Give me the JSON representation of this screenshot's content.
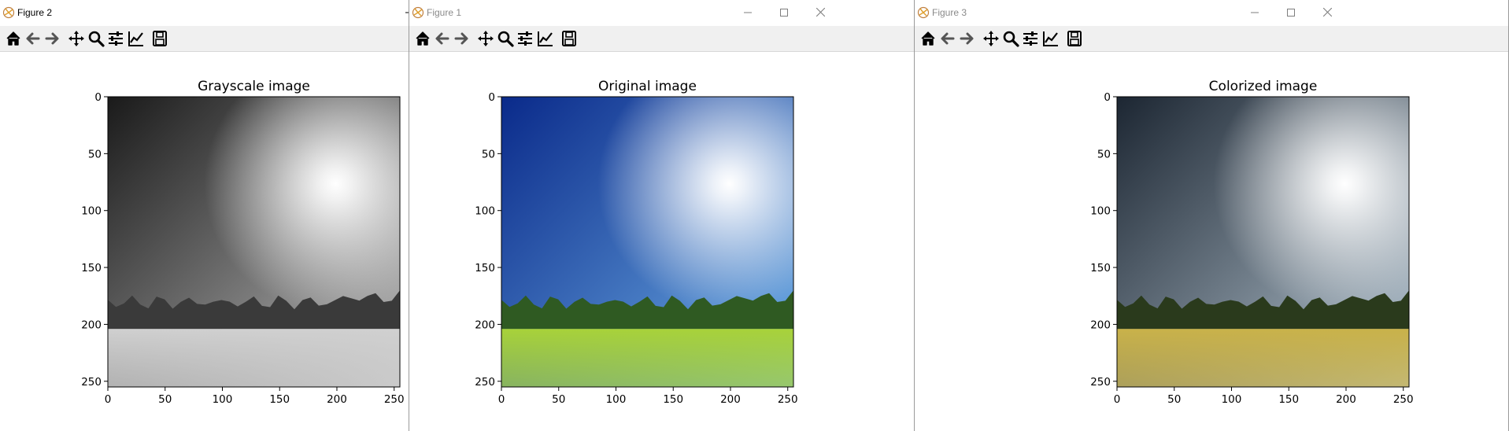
{
  "windows": [
    {
      "key": "w2",
      "title": "Figure 2",
      "active": true,
      "plot_title": "Grayscale image",
      "image": "grayscale"
    },
    {
      "key": "w1",
      "title": "Figure 1",
      "active": false,
      "plot_title": "Original image",
      "image": "original"
    },
    {
      "key": "w3",
      "title": "Figure 3",
      "active": false,
      "plot_title": "Colorized image",
      "image": "colorized"
    }
  ],
  "toolbar_icons": [
    "home-icon",
    "back-arrow-icon",
    "forward-arrow-icon",
    "pan-icon",
    "zoom-icon",
    "configure-subplots-icon",
    "edit-axis-icon",
    "save-icon"
  ],
  "axes": {
    "x_ticks": [
      "0",
      "50",
      "100",
      "150",
      "200",
      "250"
    ],
    "y_ticks": [
      "0",
      "50",
      "100",
      "150",
      "200",
      "250"
    ],
    "xlim": [
      0,
      255
    ],
    "ylim": [
      255,
      0
    ]
  },
  "colors": {
    "grayscale_sky_dark": "#1a1a1a",
    "grayscale_sky_light": "#bdbdbd",
    "grayscale_field": "#d0d0d0",
    "original_sky_dark": "#0a2a8a",
    "original_sky_light": "#6fb0e8",
    "original_field": "#a8d23a",
    "colorized_sky_dark": "#1c2632",
    "colorized_sky_light": "#b8c8d4",
    "colorized_field": "#c9b24a",
    "trees_dark": "#2a3a1c"
  }
}
